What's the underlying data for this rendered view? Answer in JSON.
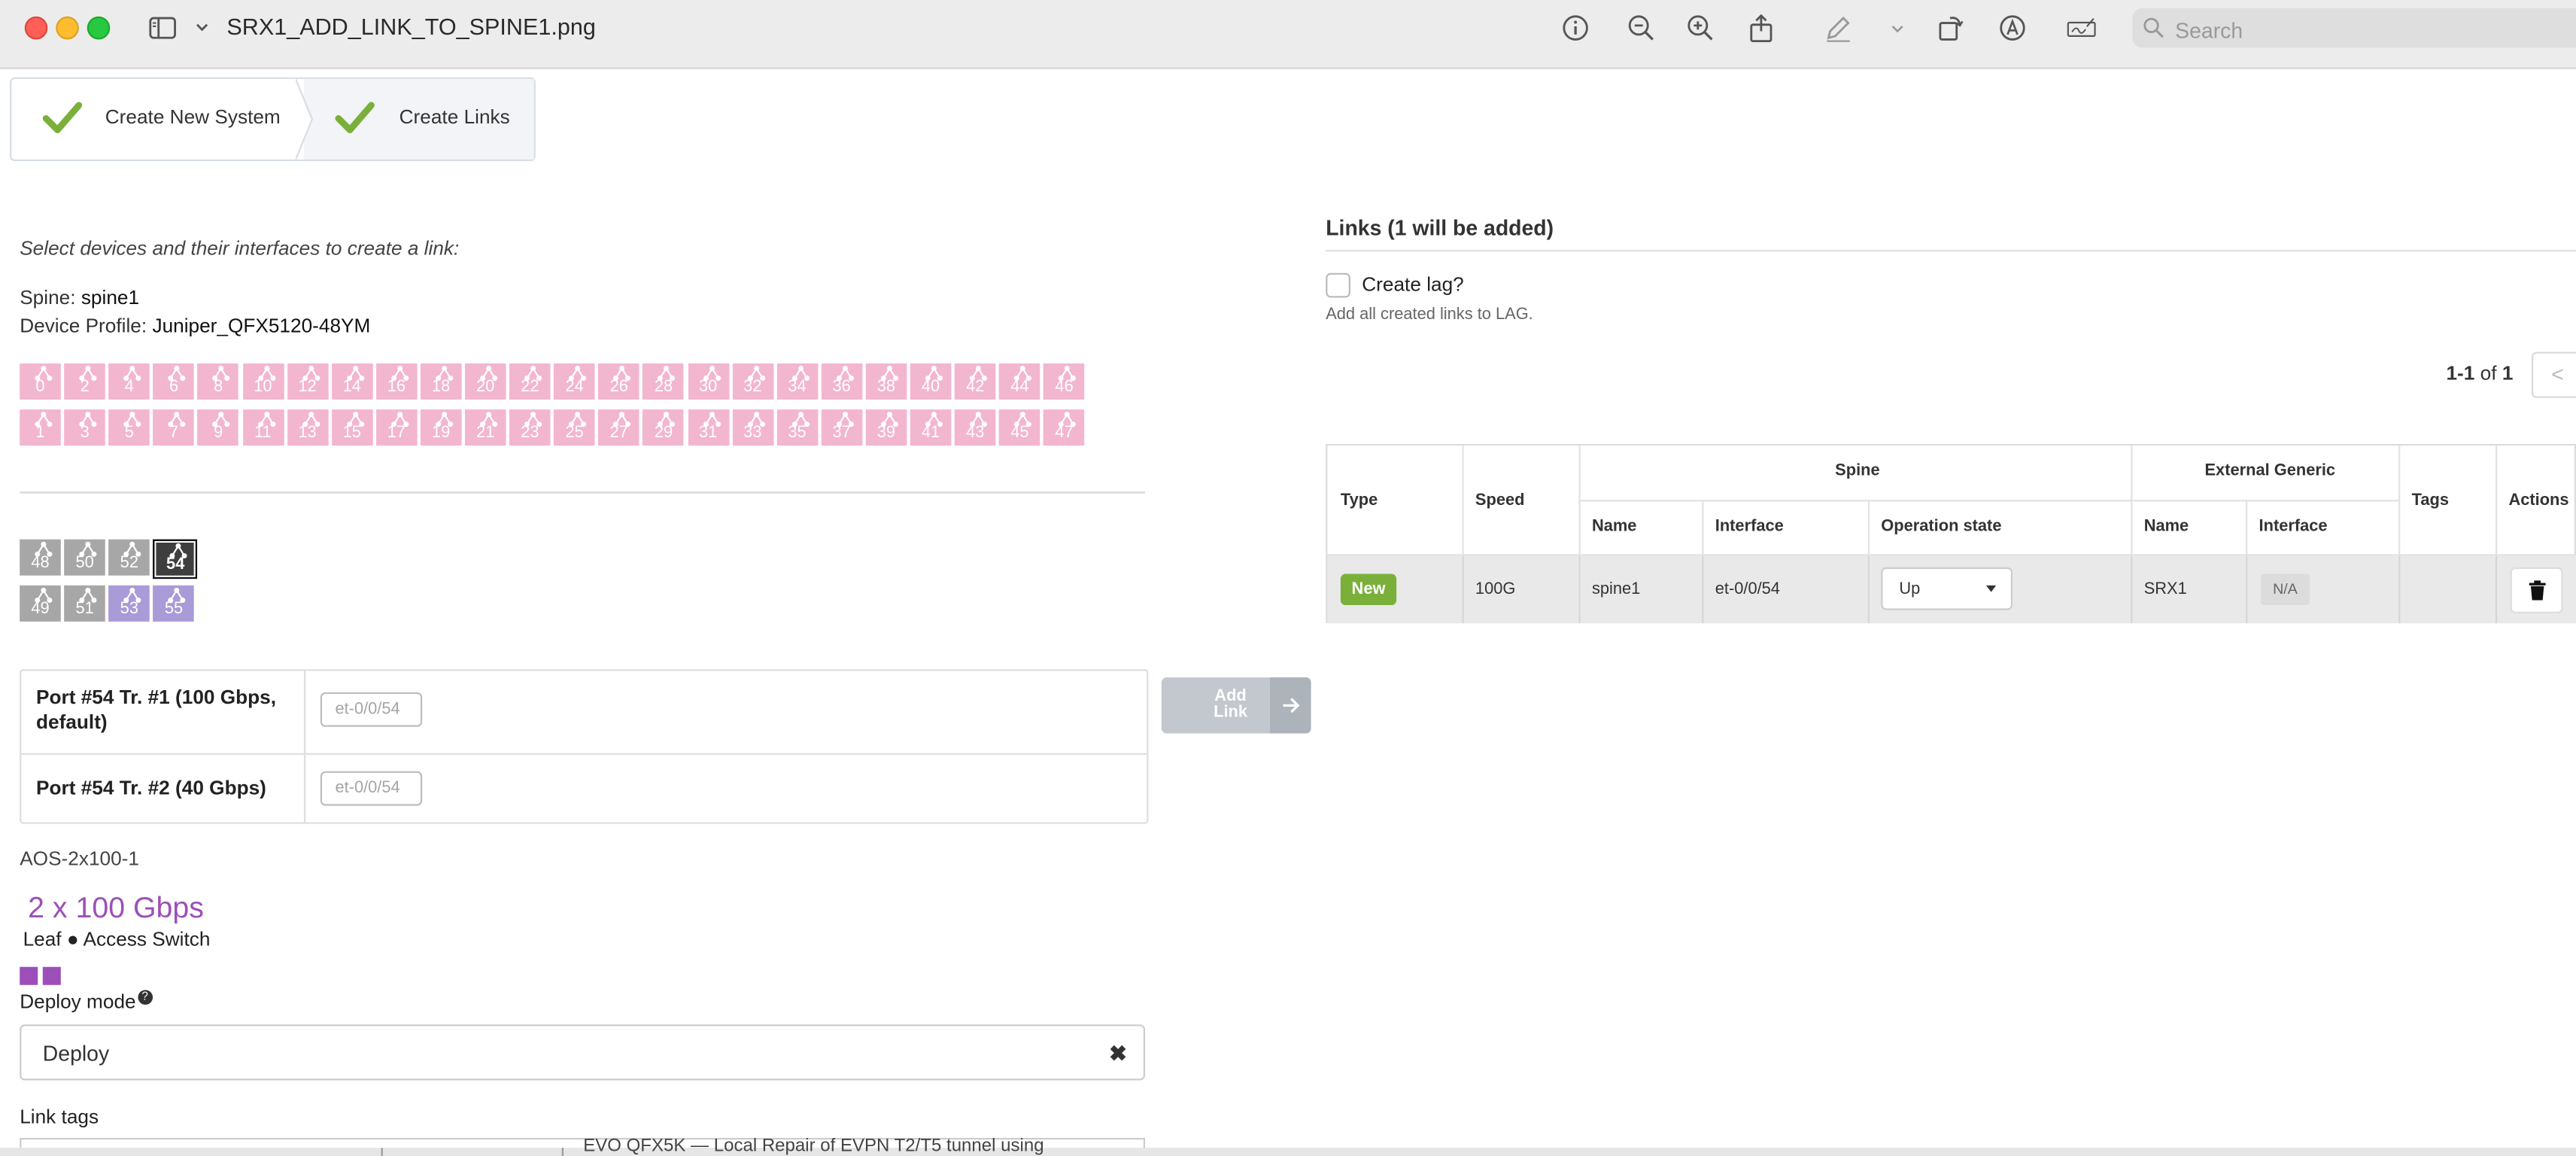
{
  "window": {
    "title": "SRX1_ADD_LINK_TO_SPINE1.png",
    "search_placeholder": "Search"
  },
  "toolbar_icons": [
    "sidebar-icon",
    "chevron-down-icon",
    "info-icon",
    "zoom-out-icon",
    "zoom-in-icon",
    "share-icon",
    "markup-pen-icon",
    "chevron-down-icon",
    "rotate-icon",
    "annotate-icon",
    "signature-icon",
    "search-icon"
  ],
  "wizard": {
    "steps": [
      {
        "label": "Create New System",
        "done": true
      },
      {
        "label": "Create Links",
        "done": true
      }
    ]
  },
  "left": {
    "hint": "Select devices and their interfaces to create a link:",
    "spine_label": "Spine:",
    "spine_value": "spine1",
    "profile_label": "Device Profile:",
    "profile_value": "Juniper_QFX5120-48YM",
    "ports_top": [
      "0",
      "2",
      "4",
      "6",
      "8",
      "10",
      "12",
      "14",
      "16",
      "18",
      "20",
      "22",
      "24",
      "26",
      "28",
      "30",
      "32",
      "34",
      "36",
      "38",
      "40",
      "42",
      "44",
      "46"
    ],
    "ports_bottom": [
      "1",
      "3",
      "5",
      "7",
      "9",
      "11",
      "13",
      "15",
      "17",
      "19",
      "21",
      "23",
      "25",
      "27",
      "29",
      "31",
      "33",
      "35",
      "37",
      "39",
      "41",
      "43",
      "45",
      "47"
    ],
    "uplinks_top": [
      "48",
      "50",
      "52",
      "54"
    ],
    "uplinks_bottom": [
      "49",
      "51",
      "53",
      "55"
    ],
    "selected_port": "54",
    "interfaces": [
      {
        "name": "Port #54 Tr. #1 (100 Gbps, default)",
        "placeholder": "et-0/0/54"
      },
      {
        "name": "Port #54 Tr. #2 (40 Gbps)",
        "placeholder": "et-0/0/54"
      }
    ],
    "add_link_label": "Add Link",
    "external_device": {
      "name": "AOS-2x100-1",
      "speed": "2 x 100 Gbps",
      "role": "Leaf ● Access Switch"
    },
    "deploy_mode_label": "Deploy mode",
    "deploy_help": "?",
    "deploy_mode_value": "Deploy",
    "deploy_clear": "✖",
    "link_tags_label": "Link tags",
    "background_text": "EVO QFX5K — Local Repair of EVPN T2/T5 tunnel using"
  },
  "right": {
    "links_title": "Links (1 will be added)",
    "create_lag_label": "Create lag?",
    "create_lag_checked": false,
    "create_lag_help": "Add all created links to LAG.",
    "pager_range": "1-1",
    "pager_of": "of",
    "pager_total": "1",
    "pager_prev": "<",
    "table": {
      "group_headers": {
        "spine": "Spine",
        "external": "External Generic"
      },
      "headers": {
        "type": "Type",
        "speed": "Speed",
        "spine_name": "Name",
        "spine_interface": "Interface",
        "operation_state": "Operation state",
        "ext_name": "Name",
        "ext_interface": "Interface",
        "tags": "Tags",
        "actions": "Actions"
      },
      "row": {
        "type": "New",
        "speed": "100G",
        "spine_name": "spine1",
        "spine_interface": "et-0/0/54",
        "operation_state": "Up",
        "ext_name": "SRX1",
        "ext_interface": "N/A",
        "tags": ""
      }
    }
  },
  "colors": {
    "port_pink": "#f3b6cf",
    "port_grey": "#a7a7a7",
    "port_purple": "#a99ad8",
    "port_selected": "#3e3e3e",
    "accent_purple": "#9c4fb8",
    "check_green": "#7ab03a",
    "new_badge": "#7ab03a"
  }
}
